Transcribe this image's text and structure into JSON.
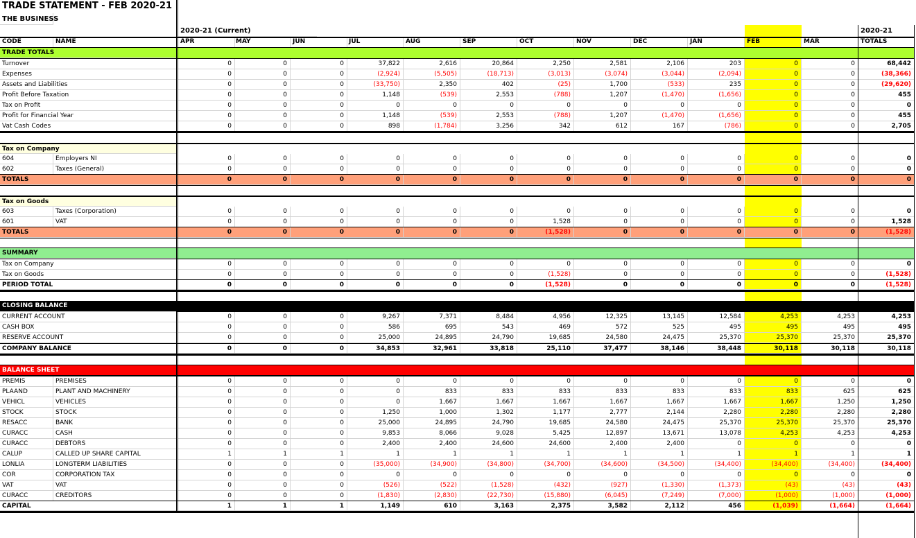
{
  "title": "TRADE STATEMENT - FEB 2020-21",
  "business": "THE BUSINESS",
  "year_label": "2020-21 (Current)",
  "totals_year_label": "2020-21",
  "headers": {
    "code": "CODE",
    "name": "NAME",
    "totals": "TOTALS"
  },
  "months": [
    "APR",
    "MAY",
    "JUN",
    "JUL",
    "AUG",
    "SEP",
    "OCT",
    "NOV",
    "DEC",
    "JAN",
    "FEB",
    "MAR"
  ],
  "highlight_month": "FEB",
  "colors": {
    "trade_totals": "#adff2f",
    "tax_header": "#ffffe0",
    "totals_row": "#ffa07a",
    "summary": "#90ee90",
    "closing": "#000000",
    "balance_sheet": "#ff0000",
    "highlight": "#ffff00",
    "negative": "#ff0000"
  },
  "sections": [
    {
      "key": "trade",
      "header": "TRADE TOTALS",
      "rows": [
        {
          "code": "Turnover",
          "name": "",
          "values": [
            "0",
            "0",
            "0",
            "37,822",
            "2,616",
            "20,864",
            "2,250",
            "2,581",
            "2,106",
            "203",
            "0",
            "0"
          ],
          "total": "68,442"
        },
        {
          "code": "Expenses",
          "name": "",
          "values": [
            "0",
            "0",
            "0",
            "(2,924)",
            "(5,505)",
            "(18,713)",
            "(3,013)",
            "(3,074)",
            "(3,044)",
            "(2,094)",
            "0",
            "0"
          ],
          "total": "(38,366)"
        },
        {
          "code": "Assets and Liabilities",
          "name": "",
          "values": [
            "0",
            "0",
            "0",
            "(33,750)",
            "2,350",
            "402",
            "(25)",
            "1,700",
            "(533)",
            "235",
            "0",
            "0"
          ],
          "total": "(29,620)"
        },
        {
          "code": "Profit Before Taxation",
          "name": "",
          "values": [
            "0",
            "0",
            "0",
            "1,148",
            "(539)",
            "2,553",
            "(788)",
            "1,207",
            "(1,470)",
            "(1,656)",
            "0",
            "0"
          ],
          "total": "455"
        },
        {
          "code": "Tax on Profit",
          "name": "",
          "values": [
            "0",
            "0",
            "0",
            "0",
            "0",
            "0",
            "0",
            "0",
            "0",
            "0",
            "0",
            "0"
          ],
          "total": "0"
        },
        {
          "code": "Profit for Financial Year",
          "name": "",
          "values": [
            "0",
            "0",
            "0",
            "1,148",
            "(539)",
            "2,553",
            "(788)",
            "1,207",
            "(1,470)",
            "(1,656)",
            "0",
            "0"
          ],
          "total": "455"
        },
        {
          "code": "Vat Cash Codes",
          "name": "",
          "values": [
            "0",
            "0",
            "0",
            "898",
            "(1,784)",
            "3,256",
            "342",
            "612",
            "167",
            "(786)",
            "0",
            "0"
          ],
          "total": "2,705"
        }
      ]
    },
    {
      "key": "tax_company",
      "header": "Tax on Company",
      "rows": [
        {
          "code": "604",
          "name": "Employers NI",
          "values": [
            "0",
            "0",
            "0",
            "0",
            "0",
            "0",
            "0",
            "0",
            "0",
            "0",
            "0",
            "0"
          ],
          "total": "0"
        },
        {
          "code": "602",
          "name": "Taxes (General)",
          "values": [
            "0",
            "0",
            "0",
            "0",
            "0",
            "0",
            "0",
            "0",
            "0",
            "0",
            "0",
            "0"
          ],
          "total": "0"
        }
      ],
      "totals": {
        "label": "TOTALS",
        "values": [
          "0",
          "0",
          "0",
          "0",
          "0",
          "0",
          "0",
          "0",
          "0",
          "0",
          "0",
          "0"
        ],
        "total": "0"
      }
    },
    {
      "key": "tax_goods",
      "header": "Tax on Goods",
      "rows": [
        {
          "code": "603",
          "name": "Taxes (Corporation)",
          "values": [
            "0",
            "0",
            "0",
            "0",
            "0",
            "0",
            "0",
            "0",
            "0",
            "0",
            "0",
            "0"
          ],
          "total": "0"
        },
        {
          "code": "601",
          "name": "VAT",
          "values": [
            "0",
            "0",
            "0",
            "0",
            "0",
            "0",
            "1,528",
            "0",
            "0",
            "0",
            "0",
            "0"
          ],
          "total": "1,528"
        }
      ],
      "totals": {
        "label": "TOTALS",
        "values": [
          "0",
          "0",
          "0",
          "0",
          "0",
          "0",
          "(1,528)",
          "0",
          "0",
          "0",
          "0",
          "0"
        ],
        "total": "(1,528)"
      }
    },
    {
      "key": "summary",
      "header": "SUMMARY",
      "rows": [
        {
          "code": "Tax on Company",
          "name": "",
          "values": [
            "0",
            "0",
            "0",
            "0",
            "0",
            "0",
            "0",
            "0",
            "0",
            "0",
            "0",
            "0"
          ],
          "total": "0"
        },
        {
          "code": "Tax on Goods",
          "name": "",
          "values": [
            "0",
            "0",
            "0",
            "0",
            "0",
            "0",
            "(1,528)",
            "0",
            "0",
            "0",
            "0",
            "0"
          ],
          "total": "(1,528)"
        }
      ],
      "period_total": {
        "label": "PERIOD TOTAL",
        "values": [
          "0",
          "0",
          "0",
          "0",
          "0",
          "0",
          "(1,528)",
          "0",
          "0",
          "0",
          "0",
          "0"
        ],
        "total": "(1,528)"
      }
    },
    {
      "key": "closing",
      "header": "CLOSING BALANCE",
      "rows": [
        {
          "code": "CURRENT ACCOUNT",
          "name": "",
          "values": [
            "0",
            "0",
            "0",
            "9,267",
            "7,371",
            "8,484",
            "4,956",
            "12,325",
            "13,145",
            "12,584",
            "4,253",
            "4,253"
          ],
          "total": "4,253"
        },
        {
          "code": "CASH BOX",
          "name": "",
          "values": [
            "0",
            "0",
            "0",
            "586",
            "695",
            "543",
            "469",
            "572",
            "525",
            "495",
            "495",
            "495"
          ],
          "total": "495"
        },
        {
          "code": "RESERVE ACCOUNT",
          "name": "",
          "values": [
            "0",
            "0",
            "0",
            "25,000",
            "24,895",
            "24,790",
            "19,685",
            "24,580",
            "24,475",
            "25,370",
            "25,370",
            "25,370"
          ],
          "total": "25,370"
        }
      ],
      "company_balance": {
        "label": "COMPANY BALANCE",
        "values": [
          "0",
          "0",
          "0",
          "34,853",
          "32,961",
          "33,818",
          "25,110",
          "37,477",
          "38,146",
          "38,448",
          "30,118",
          "30,118"
        ],
        "total": "30,118"
      }
    },
    {
      "key": "balance",
      "header": "BALANCE SHEET",
      "rows": [
        {
          "code": "PREMIS",
          "name": "PREMISES",
          "values": [
            "0",
            "0",
            "0",
            "0",
            "0",
            "0",
            "0",
            "0",
            "0",
            "0",
            "0",
            "0"
          ],
          "total": "0"
        },
        {
          "code": "PLAAND",
          "name": "PLANT AND MACHINERY",
          "values": [
            "0",
            "0",
            "0",
            "0",
            "833",
            "833",
            "833",
            "833",
            "833",
            "833",
            "833",
            "625"
          ],
          "total": "625"
        },
        {
          "code": "VEHICL",
          "name": "VEHICLES",
          "values": [
            "0",
            "0",
            "0",
            "0",
            "1,667",
            "1,667",
            "1,667",
            "1,667",
            "1,667",
            "1,667",
            "1,667",
            "1,250"
          ],
          "total": "1,250"
        },
        {
          "code": "STOCK",
          "name": "STOCK",
          "values": [
            "0",
            "0",
            "0",
            "1,250",
            "1,000",
            "1,302",
            "1,177",
            "2,777",
            "2,144",
            "2,280",
            "2,280",
            "2,280"
          ],
          "total": "2,280"
        },
        {
          "code": "RESACC",
          "name": "BANK",
          "values": [
            "0",
            "0",
            "0",
            "25,000",
            "24,895",
            "24,790",
            "19,685",
            "24,580",
            "24,475",
            "25,370",
            "25,370",
            "25,370"
          ],
          "total": "25,370"
        },
        {
          "code": "CURACC",
          "name": "CASH",
          "values": [
            "0",
            "0",
            "0",
            "9,853",
            "8,066",
            "9,028",
            "5,425",
            "12,897",
            "13,671",
            "13,078",
            "4,253",
            "4,253"
          ],
          "total": "4,253"
        },
        {
          "code": "CURACC",
          "name": "DEBTORS",
          "values": [
            "0",
            "0",
            "0",
            "2,400",
            "2,400",
            "24,600",
            "24,600",
            "2,400",
            "2,400",
            "0",
            "0",
            "0"
          ],
          "total": "0"
        },
        {
          "code": "CALUP",
          "name": "CALLED UP SHARE CAPITAL",
          "values": [
            "1",
            "1",
            "1",
            "1",
            "1",
            "1",
            "1",
            "1",
            "1",
            "1",
            "1",
            "1"
          ],
          "total": "1"
        },
        {
          "code": "LONLIA",
          "name": "LONGTERM LIABILITIES",
          "values": [
            "0",
            "0",
            "0",
            "(35,000)",
            "(34,900)",
            "(34,800)",
            "(34,700)",
            "(34,600)",
            "(34,500)",
            "(34,400)",
            "(34,400)",
            "(34,400)"
          ],
          "total": "(34,400)"
        },
        {
          "code": "COR",
          "name": "CORPORATION TAX",
          "values": [
            "0",
            "0",
            "0",
            "0",
            "0",
            "0",
            "0",
            "0",
            "0",
            "0",
            "0",
            "0"
          ],
          "total": "0"
        },
        {
          "code": "VAT",
          "name": "VAT",
          "values": [
            "0",
            "0",
            "0",
            "(526)",
            "(522)",
            "(1,528)",
            "(432)",
            "(927)",
            "(1,330)",
            "(1,373)",
            "(43)",
            "(43)"
          ],
          "total": "(43)"
        },
        {
          "code": "CURACC",
          "name": "CREDITORS",
          "values": [
            "0",
            "0",
            "0",
            "(1,830)",
            "(2,830)",
            "(22,730)",
            "(15,880)",
            "(6,045)",
            "(7,249)",
            "(7,000)",
            "(1,000)",
            "(1,000)"
          ],
          "total": "(1,000)"
        }
      ],
      "capital": {
        "label": "CAPITAL",
        "values": [
          "1",
          "1",
          "1",
          "1,149",
          "610",
          "3,163",
          "2,375",
          "3,582",
          "2,112",
          "456",
          "(1,039)",
          "(1,664)"
        ],
        "total": "(1,664)"
      }
    }
  ]
}
